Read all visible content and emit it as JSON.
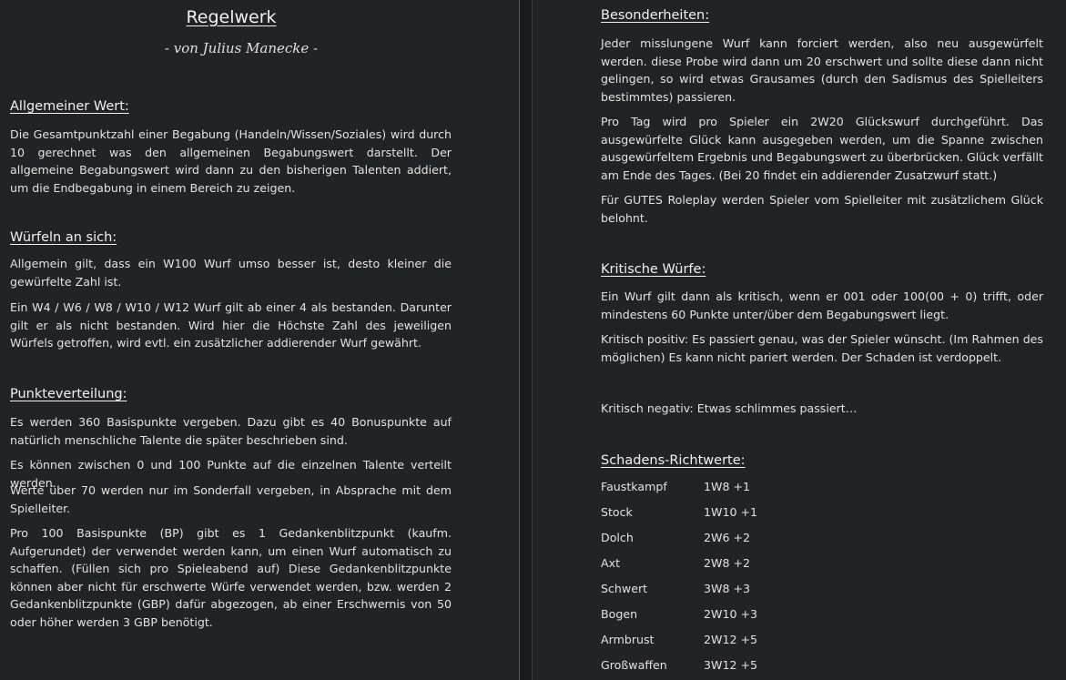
{
  "left": {
    "title": "Regelwerk",
    "author": "-   von Julius Manecke -",
    "sections": {
      "allgemein": {
        "heading": "Allgemeiner Wert:",
        "paragraphs": [
          "Die Gesamtpunktzahl einer Begabung (Handeln/Wissen/Soziales) wird durch 10 gerechnet was den allgemeinen Begabungswert darstellt. Der allgemeine Begabungswert wird dann zu den bisherigen Talenten addiert, um die Endbegabung in einem Bereich zu zeigen."
        ]
      },
      "wuerfeln": {
        "heading": "Würfeln an sich:",
        "paragraphs": [
          "Allgemein gilt, dass ein W100 Wurf umso besser ist, desto kleiner die gewürfelte Zahl ist.",
          "Ein W4 / W6 / W8 / W10 / W12 Wurf gilt ab einer 4 als bestanden. Darunter gilt er als nicht bestanden. Wird hier die Höchste Zahl des jeweiligen Würfels getroffen, wird evtl. ein zusätzlicher addierender Wurf gewährt."
        ]
      },
      "punkte": {
        "heading": "Punkteverteilung:",
        "paragraphs": [
          "Es werden 360 Basispunkte vergeben. Dazu gibt es 40 Bonuspunkte auf natürlich menschliche Talente die später beschrieben sind.",
          "Es können zwischen 0 und 100 Punkte auf die einzelnen Talente verteilt werden.",
          "Werte über 70 werden nur im Sonderfall vergeben, in Absprache mit dem Spielleiter.",
          "Pro 100 Basispunkte (BP) gibt es 1 Gedankenblitzpunkt (kaufm. Aufgerundet) der verwendet werden kann, um einen Wurf automatisch zu schaffen. (Füllen sich pro Spieleabend auf) Diese Gedankenblitzpunkte können aber nicht für erschwerte Würfe verwendet werden, bzw. werden 2 Gedankenblitzpunkte (GBP) dafür abgezogen, ab einer Erschwernis von 50 oder höher werden 3 GBP benötigt."
        ]
      }
    }
  },
  "right": {
    "sections": {
      "besonderheiten": {
        "heading": "Besonderheiten:",
        "paragraphs": [
          "Jeder misslungene Wurf kann forciert werden, also neu ausgewürfelt werden. diese Probe wird dann um 20 erschwert und sollte diese dann nicht gelingen, so wird etwas Grausames (durch den Sadismus des Spielleiters bestimmtes) passieren.",
          "Pro Tag wird pro Spieler ein 2W20 Glückswurf durchgeführt. Das ausgewürfelte Glück kann ausgegeben werden, um die Spanne zwischen ausgewürfeltem Ergebnis und Begabungswert zu überbrücken. Glück verfällt am Ende des Tages. (Bei 20 findet ein addierender Zusatzwurf statt.)",
          "Für GUTES Roleplay werden Spieler vom Spielleiter mit zusätzlichem Glück belohnt."
        ]
      },
      "kritisch": {
        "heading": "Kritische Würfe:",
        "paragraphs": [
          "Ein Wurf gilt dann als kritisch, wenn er 001 oder 100(00 + 0) trifft, oder mindestens 60 Punkte unter/über dem Begabungswert liegt.",
          "Kritisch positiv: Es passiert genau, was der Spieler wünscht. (Im Rahmen des möglichen) Es kann nicht pariert werden. Der Schaden ist verdoppelt.",
          "Kritisch negativ: Etwas schlimmes passiert…"
        ]
      },
      "schaden": {
        "heading": "Schadens-Richtwerte:",
        "rows": [
          {
            "name": "Faustkampf",
            "value": "1W8 +1"
          },
          {
            "name": "Stock",
            "value": "1W10 +1"
          },
          {
            "name": "Dolch",
            "value": "2W6 +2"
          },
          {
            "name": "Axt",
            "value": "2W8 +2"
          },
          {
            "name": "Schwert",
            "value": "3W8 +3"
          },
          {
            "name": "Bogen",
            "value": "2W10 +3"
          },
          {
            "name": "Armbrust",
            "value": "2W12 +5"
          },
          {
            "name": "Großwaffen",
            "value": "3W12 +5"
          }
        ]
      }
    }
  }
}
